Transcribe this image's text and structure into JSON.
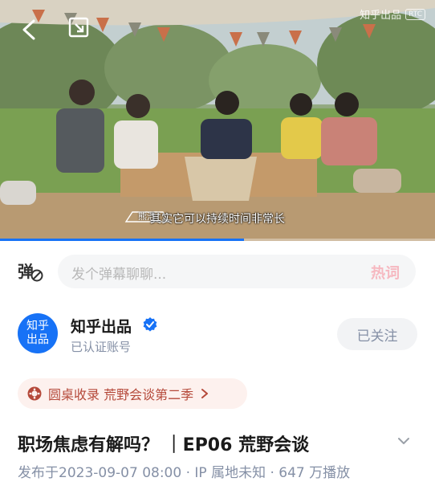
{
  "video": {
    "watermark": "知乎出品",
    "watermark_badge": "RTC",
    "speaker_tag": "熊浩",
    "subtitle": "其实它可以持续时间非常长",
    "progress_fraction": 0.56
  },
  "danmaku": {
    "toggle_icon": "danmaku-toggle-icon",
    "placeholder": "发个弹幕聊聊...",
    "hot_words_label": "热词"
  },
  "author": {
    "avatar_text_line1": "知乎",
    "avatar_text_line2": "出品",
    "name": "知乎出品",
    "verified_icon": "verified-badge-icon",
    "subtitle": "已认证账号",
    "follow_label": "已关注"
  },
  "collection": {
    "label": "圆桌收录",
    "name": "荒野会谈第二季",
    "text": "圆桌收录 荒野会谈第二季",
    "accent": "#b5493a"
  },
  "video_info": {
    "title": "职场焦虑有解吗？ ｜EP06 荒野会谈",
    "meta": "发布于2023-09-07 08:00 · IP 属地未知 · 647 万播放"
  },
  "colors": {
    "brand_blue": "#1772f6",
    "muted_text": "#8590a6",
    "hot_word_pink": "#f6b8c0"
  }
}
